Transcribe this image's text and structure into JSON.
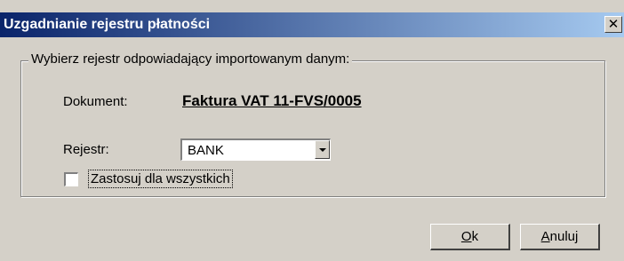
{
  "window": {
    "title": "Uzgadnianie rejestru płatności",
    "close_glyph": "✕",
    "close_icon": "close-icon"
  },
  "group": {
    "legend": "Wybierz rejestr odpowiadający importowanym danym:"
  },
  "document": {
    "label": "Dokument:",
    "value": "Faktura VAT 11-FVS/0005"
  },
  "register": {
    "label": "Rejestr:",
    "selected": "BANK",
    "dropdown_icon": "chevron-down-icon"
  },
  "apply_all": {
    "label": "Zastosuj dla wszystkich",
    "checked": false
  },
  "buttons": {
    "ok_accel": "O",
    "ok_rest": "k",
    "cancel_accel": "A",
    "cancel_rest": "nuluj"
  },
  "colors": {
    "face": "#d4d0c8",
    "title_start": "#0a246a",
    "title_end": "#a6caf0"
  }
}
